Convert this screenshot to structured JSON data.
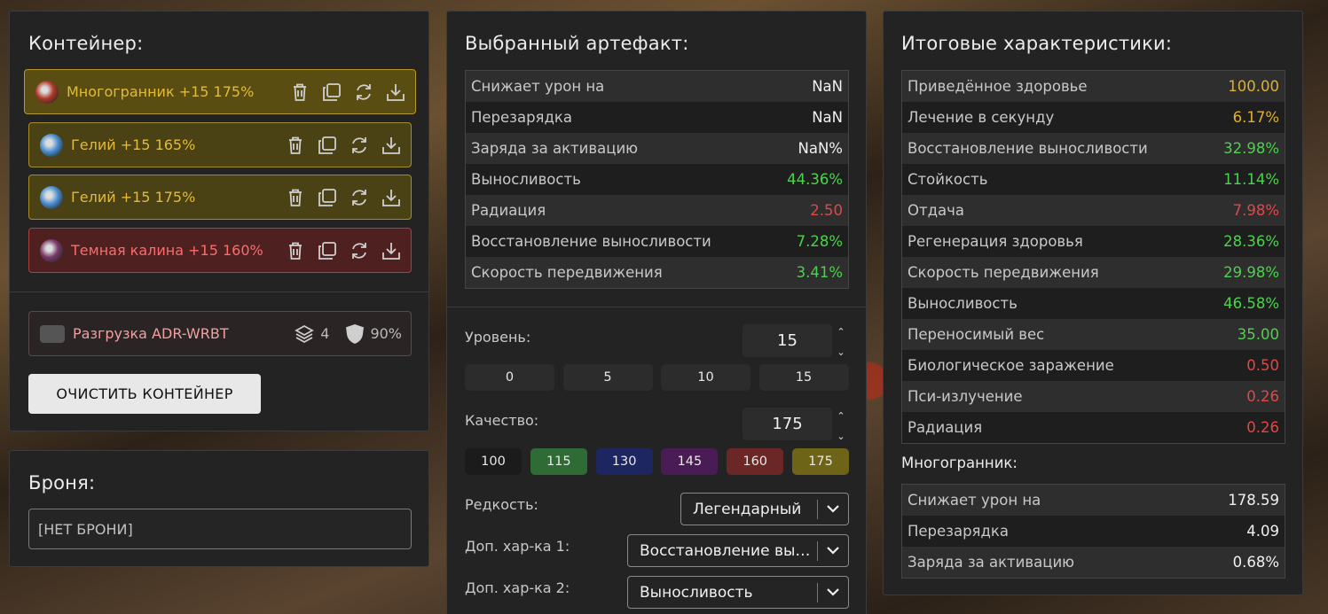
{
  "container": {
    "title": "Контейнер:",
    "artifacts": [
      {
        "label": "Многогранник +15 175%",
        "style": "gold",
        "icon_color": "#b03a2a"
      },
      {
        "label": "Гелий +15 165%",
        "style": "gold2",
        "icon_color": "#4a8fd0"
      },
      {
        "label": "Гелий +15 175%",
        "style": "gold2",
        "icon_color": "#4a8fd0"
      },
      {
        "label": "Темная калина +15 160%",
        "style": "red",
        "icon_color": "#7a3a6a"
      }
    ],
    "vest": {
      "label": "Разгрузка ADR-WRBT",
      "slots": "4",
      "protection": "90%"
    },
    "clear_button": "ОЧИСТИТЬ КОНТЕЙНЕР"
  },
  "armor": {
    "title": "Броня:",
    "value": "[НЕТ БРОНИ]"
  },
  "artifact": {
    "title": "Выбранный артефакт:",
    "stats": [
      {
        "name": "Снижает урон на",
        "value": "NaN",
        "tone": "white"
      },
      {
        "name": "Перезарядка",
        "value": "NaN",
        "tone": "white"
      },
      {
        "name": "Заряда за активацию",
        "value": "NaN%",
        "tone": "white"
      },
      {
        "name": "Выносливость",
        "value": "44.36%",
        "tone": "green"
      },
      {
        "name": "Радиация",
        "value": "2.50",
        "tone": "red"
      },
      {
        "name": "Восстановление выносливости",
        "value": "7.28%",
        "tone": "green"
      },
      {
        "name": "Скорость передвижения",
        "value": "3.41%",
        "tone": "green"
      }
    ],
    "level_label": "Уровень:",
    "level_value": "15",
    "level_presets": [
      "0",
      "5",
      "10",
      "15"
    ],
    "quality_label": "Качество:",
    "quality_value": "175",
    "quality_presets": [
      {
        "label": "100",
        "color": "#1b1b1b"
      },
      {
        "label": "115",
        "color": "#2f6b35"
      },
      {
        "label": "130",
        "color": "#1d2660"
      },
      {
        "label": "145",
        "color": "#4a1c55"
      },
      {
        "label": "160",
        "color": "#6b2626"
      },
      {
        "label": "175",
        "color": "#6e6418"
      }
    ],
    "rarity_label": "Редкость:",
    "rarity_value": "Легендарный",
    "extra1_label": "Доп. хар-ка 1:",
    "extra1_value": "Восстановление выносливости",
    "extra2_label": "Доп. хар-ка 2:",
    "extra2_value": "Выносливость"
  },
  "summary": {
    "title": "Итоговые характеристики:",
    "stats": [
      {
        "name": "Приведённое здоровье",
        "value": "100.00",
        "tone": "gold"
      },
      {
        "name": "Лечение в секунду",
        "value": "6.17%",
        "tone": "gold"
      },
      {
        "name": "Восстановление выносливости",
        "value": "32.98%",
        "tone": "green"
      },
      {
        "name": "Стойкость",
        "value": "11.14%",
        "tone": "green"
      },
      {
        "name": "Отдача",
        "value": "7.98%",
        "tone": "red"
      },
      {
        "name": "Регенерация здоровья",
        "value": "28.36%",
        "tone": "green"
      },
      {
        "name": "Скорость передвижения",
        "value": "29.98%",
        "tone": "green"
      },
      {
        "name": "Выносливость",
        "value": "46.58%",
        "tone": "green"
      },
      {
        "name": "Переносимый вес",
        "value": "35.00",
        "tone": "green"
      },
      {
        "name": "Биологическое заражение",
        "value": "0.50",
        "tone": "red"
      },
      {
        "name": "Пси-излучение",
        "value": "0.26",
        "tone": "red"
      },
      {
        "name": "Радиация",
        "value": "0.26",
        "tone": "red"
      }
    ],
    "sub_title": "Многогранник:",
    "sub_stats": [
      {
        "name": "Снижает урон на",
        "value": "178.59",
        "tone": "white"
      },
      {
        "name": "Перезарядка",
        "value": "4.09",
        "tone": "white"
      },
      {
        "name": "Заряда за активацию",
        "value": "0.68%",
        "tone": "white"
      }
    ]
  }
}
